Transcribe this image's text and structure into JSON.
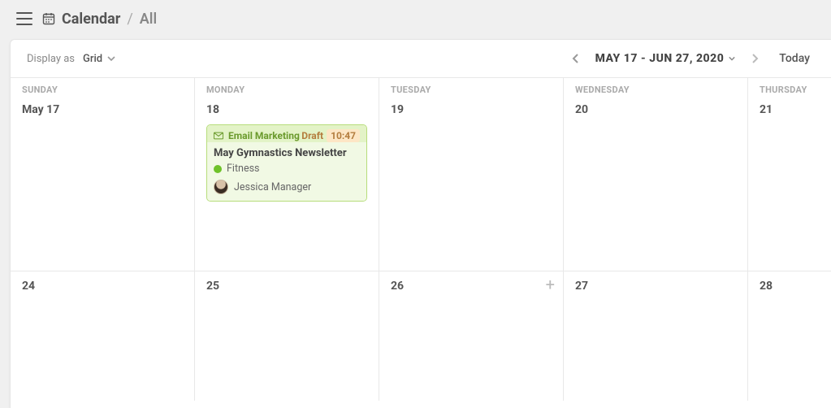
{
  "breadcrumb": {
    "title": "Calendar",
    "sub": "All"
  },
  "toolbar": {
    "display_label": "Display as",
    "display_value": "Grid",
    "date_range": "MAY 17 - JUN 27, 2020",
    "today": "Today"
  },
  "week_headers": [
    "SUNDAY",
    "MONDAY",
    "TUESDAY",
    "WEDNESDAY",
    "THURSDAY"
  ],
  "week1_days": [
    "May 17",
    "18",
    "19",
    "20",
    "21"
  ],
  "week2_days": [
    "24",
    "25",
    "26",
    "27",
    "28"
  ],
  "event": {
    "type_label": "Email Marketing",
    "status_label": "Draft",
    "time": "10:47",
    "title": "May Gymnastics Newsletter",
    "tag": "Fitness",
    "tag_color": "#6ec229",
    "person": "Jessica Manager"
  }
}
